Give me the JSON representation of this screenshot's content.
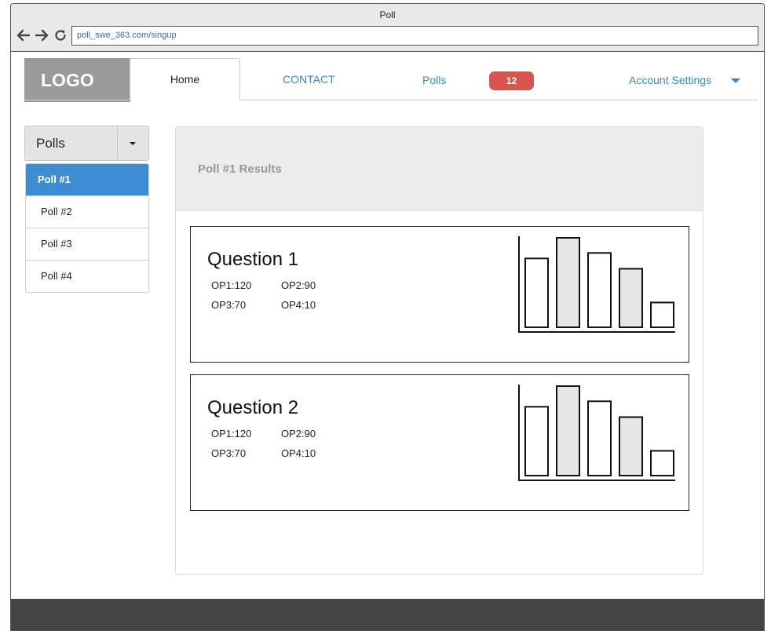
{
  "browser": {
    "title": "Poll",
    "url": "poll_swe_363.com/singup",
    "icons": [
      "back-arrow-icon",
      "forward-arrow-icon",
      "reload-icon"
    ]
  },
  "header": {
    "logo": "LOGO",
    "home_tab": "Home",
    "contact": "CONTACT",
    "polls": "Polls",
    "polls_badge": "12",
    "account_settings": "Account Settings"
  },
  "sidebar": {
    "dropdown_label": "Polls",
    "items": [
      {
        "label": "Poll #1",
        "active": true
      },
      {
        "label": "Poll #2",
        "active": false
      },
      {
        "label": "Poll #3",
        "active": false
      },
      {
        "label": "Poll #4",
        "active": false
      }
    ]
  },
  "main": {
    "panel_title": "Poll #1 Results",
    "questions": [
      {
        "title": "Question 1",
        "op1": "OP1:120",
        "op2": "OP2:90",
        "op3": "OP3:70",
        "op4": "OP4:10"
      },
      {
        "title": "Question 2",
        "op1": "OP1:120",
        "op2": "OP2:90",
        "op3": "OP3:70",
        "op4": "OP4:10"
      }
    ]
  },
  "colors": {
    "accent": "#3d8bd0",
    "link": "#3d86c6",
    "badge": "#d9534f",
    "logo_bg": "#9a9a9a",
    "footer": "#444444"
  },
  "chart_data": [
    {
      "type": "bar",
      "values": [
        100,
        130,
        108,
        85,
        36
      ],
      "shaded": [
        false,
        true,
        false,
        true,
        false
      ],
      "ylim": [
        0,
        130
      ]
    },
    {
      "type": "bar",
      "values": [
        100,
        130,
        108,
        85,
        36
      ],
      "shaded": [
        false,
        true,
        false,
        true,
        false
      ],
      "ylim": [
        0,
        130
      ]
    }
  ]
}
